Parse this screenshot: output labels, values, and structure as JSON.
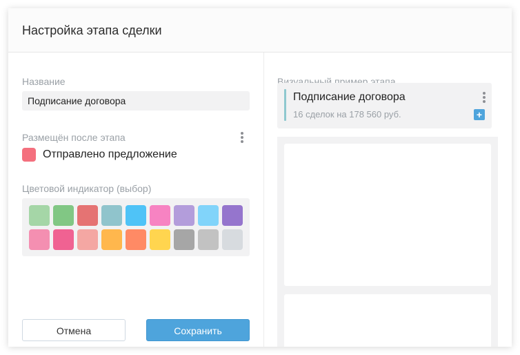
{
  "dialog": {
    "title": "Настройка этапа сделки"
  },
  "form": {
    "name_label": "Название",
    "name_value": "Подписание договора",
    "after_label": "Размещён после этапа",
    "after_value": "Отправлено предложение",
    "after_color": "#f4707e",
    "color_label": "Цветовой индикатор (выбор)",
    "palette": [
      [
        "#a5d6a7",
        "#81c784",
        "#e57373",
        "#90c4cc",
        "#4fc3f7",
        "#f783c2",
        "#b39ddb",
        "#81d4fa",
        "#9575cd"
      ],
      [
        "#f48fb1",
        "#f06292",
        "#f4a7a3",
        "#ffb74d",
        "#ff8a65",
        "#ffd54f",
        "#a6a6a6",
        "#c2c2c2",
        "#d7dbdf"
      ]
    ]
  },
  "buttons": {
    "cancel": "Отмена",
    "save": "Сохранить"
  },
  "preview": {
    "label": "Визуальный пример этапа",
    "card_title": "Подписание договора",
    "card_subtitle": "16 сделок на 178 560 руб.",
    "accent_color": "#8ec8cf",
    "plus_icon": "+"
  }
}
